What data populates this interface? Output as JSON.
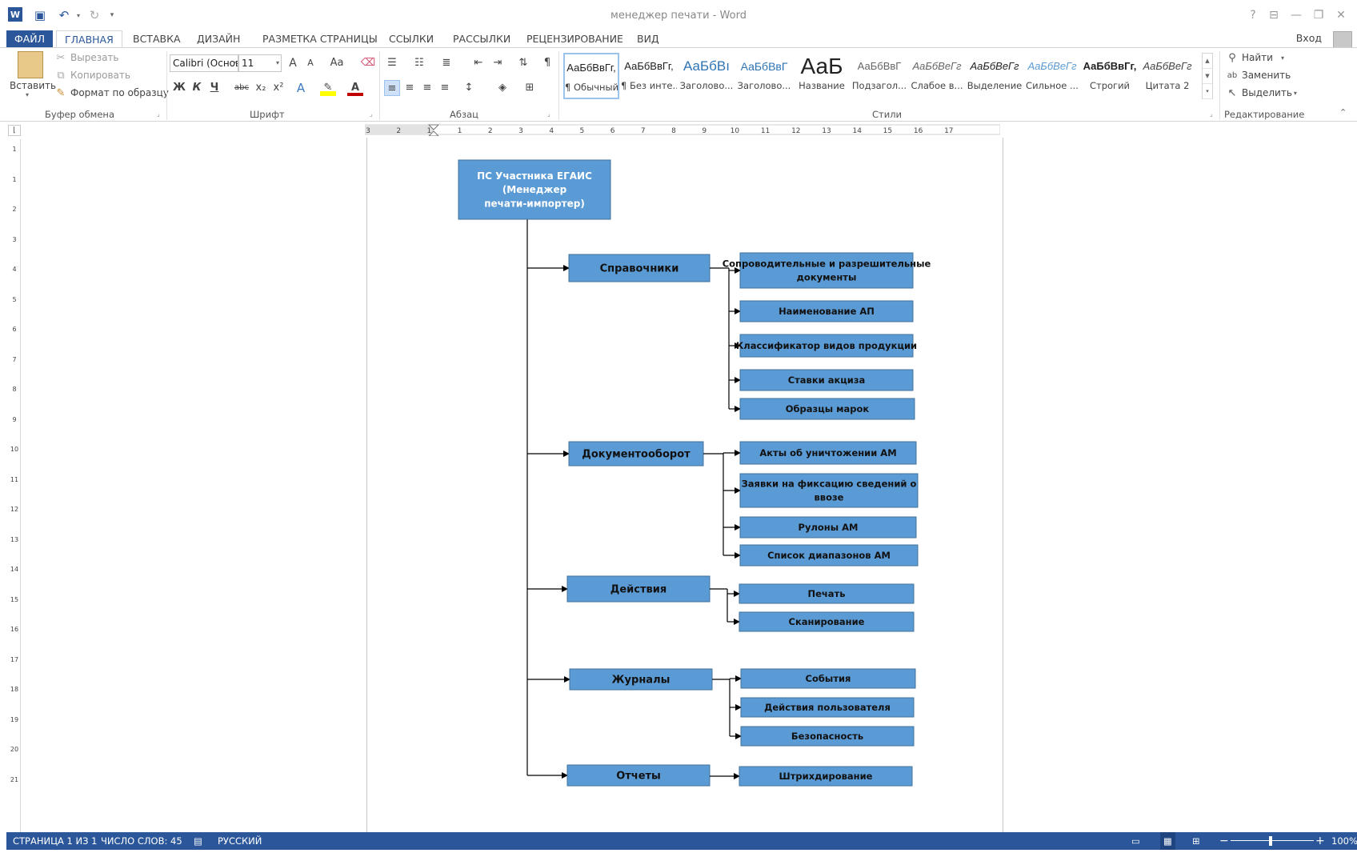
{
  "window": {
    "title": "менеджер печати - Word",
    "help_label": "?",
    "signin_label": "Вход"
  },
  "tabs": [
    {
      "label": "ФАЙЛ"
    },
    {
      "label": "ГЛАВНАЯ"
    },
    {
      "label": "ВСТАВКА"
    },
    {
      "label": "ДИЗАЙН"
    },
    {
      "label": "РАЗМЕТКА СТРАНИЦЫ"
    },
    {
      "label": "ССЫЛКИ"
    },
    {
      "label": "РАССЫЛКИ"
    },
    {
      "label": "РЕЦЕНЗИРОВАНИЕ"
    },
    {
      "label": "ВИД"
    }
  ],
  "ribbon": {
    "clipboard": {
      "group_label": "Буфер обмена",
      "paste": "Вставить",
      "cut": "Вырезать",
      "copy": "Копировать",
      "format_painter": "Формат по образцу"
    },
    "font": {
      "group_label": "Шрифт",
      "font_name": "Calibri (Основ",
      "font_size": "11",
      "case_label": "Aa",
      "bold": "Ж",
      "italic": "К",
      "underline": "Ч",
      "strike": "abc",
      "subscript": "x₂",
      "superscript": "x²",
      "grow": "A",
      "shrink": "A",
      "effects": "A",
      "color": "A"
    },
    "paragraph": {
      "group_label": "Абзац"
    },
    "styles": {
      "group_label": "Стили",
      "items": [
        {
          "preview": "АаБбВвГг,",
          "name": "¶ Обычный"
        },
        {
          "preview": "АаБбВвГг,",
          "name": "¶ Без инте..."
        },
        {
          "preview": "АаБбВı",
          "name": "Заголово..."
        },
        {
          "preview": "АаБбВвГ",
          "name": "Заголово..."
        },
        {
          "preview": "АаБ",
          "name": "Название"
        },
        {
          "preview": "АаБбВвГ",
          "name": "Подзагол..."
        },
        {
          "preview": "АаБбВеГг",
          "name": "Слабое в..."
        },
        {
          "preview": "АаБбВеГг",
          "name": "Выделение"
        },
        {
          "preview": "АаБбВеГг",
          "name": "Сильное ..."
        },
        {
          "preview": "АаБбВвГг,",
          "name": "Строгий"
        },
        {
          "preview": "АаБбВеГг",
          "name": "Цитата 2"
        }
      ]
    },
    "editing": {
      "group_label": "Редактирование",
      "find": "Найти",
      "replace": "Заменить",
      "select": "Выделить"
    }
  },
  "ruler": {
    "h_ticks": [
      "3",
      "2",
      "1",
      "1",
      "2",
      "3",
      "4",
      "5",
      "6",
      "7",
      "8",
      "9",
      "10",
      "11",
      "12",
      "13",
      "14",
      "15",
      "16",
      "17"
    ],
    "v_ticks": [
      "1",
      "1",
      "2",
      "3",
      "4",
      "5",
      "6",
      "7",
      "8",
      "9",
      "10",
      "11",
      "12",
      "13",
      "14",
      "15",
      "16",
      "17",
      "18",
      "19",
      "20",
      "21"
    ]
  },
  "diagram": {
    "root": "ПС Участника ЕГАИС (Менеджер печати-импортер)",
    "branches": [
      {
        "label": "Справочники",
        "children": [
          "Сопроводительные и разрешительные документы",
          "Наименование АП",
          "Классификатор видов продукции",
          "Ставки акциза",
          "Образцы марок"
        ]
      },
      {
        "label": "Документооборот",
        "children": [
          "Акты об уничтожении АМ",
          "Заявки на фиксацию сведений о ввозе",
          "Рулоны АМ",
          "Список диапазонов АМ"
        ]
      },
      {
        "label": "Действия",
        "children": [
          "Печать",
          "Сканирование"
        ]
      },
      {
        "label": "Журналы",
        "children": [
          "События",
          "Действия пользователя",
          "Безопасность"
        ]
      },
      {
        "label": "Отчеты",
        "children": [
          "Штрихдирование"
        ]
      }
    ],
    "box_color": "#5b9bd5",
    "border_color": "#41719c"
  },
  "status": {
    "page": "СТРАНИЦА 1 ИЗ 1",
    "words": "ЧИСЛО СЛОВ: 45",
    "language": "РУССКИЙ",
    "zoom": "100%",
    "zoom_minus": "−",
    "zoom_plus": "+"
  }
}
